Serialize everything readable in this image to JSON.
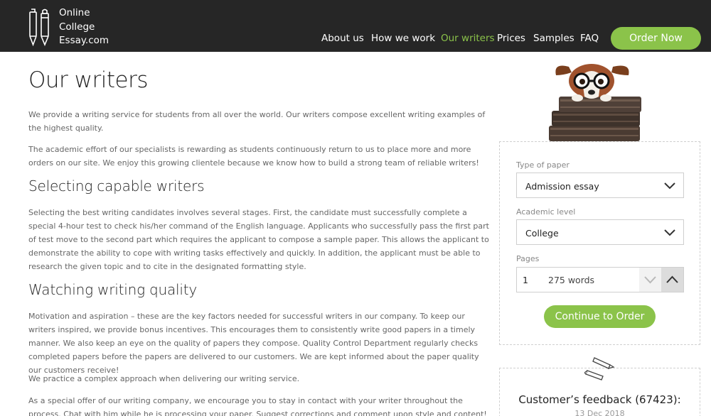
{
  "brand": {
    "line1": "Online",
    "line2": "College",
    "line3": "Essay.com"
  },
  "nav": {
    "items": [
      "About us",
      "How we work",
      "Our writers",
      "Prices",
      "Samples",
      "FAQ"
    ],
    "active": "Our writers",
    "order_label": "Order Now"
  },
  "colors": {
    "header_bg": "#262626",
    "accent": "#8bc34a"
  },
  "main": {
    "title": "Our writers",
    "intro_1": "We provide a writing service for students from all over the world. Our writers compose excellent writing examples of the highest quality.",
    "intro_2": "The academic effort of our specialists is rewarding as students continuously return to us to place more and more orders on our site. We enjoy this growing clientele because we know how to build a strong team of reliable writers!",
    "h_selecting": "Selecting capable writers",
    "selecting_text": "Selecting the best writing candidates involves several stages. First, the candidate must successfully complete a special 4-hour test to check his/her command of the English language. Applicants who successfully pass the first part of test move to the second part which requires the applicant to compose a sample paper. This allows the applicant to demonstrate the ability to cope with writing tasks effectively and quickly. In addition, the applicant must be able to research the given topic and to cite in the designated formatting style.",
    "h_watching": "Watching writing quality",
    "watching_text": "Motivation and aspiration – these are the key factors needed for successful writers in our company. To keep our writers inspired, we provide bonus incentives. This encourages them to consistently write good papers in a timely manner. We also keep an eye on the quality of papers they compose. Quality Control Department regularly checks completed papers before the papers are delivered to our customers. We are kept informed about the paper quality our customers receive!",
    "complex_text": "We practice a complex approach when delivering our writing service.",
    "offer_text": "As a special offer of our writing company, we encourage you to stay in contact with your writer throughout the process. Chat with him while he is processing your paper. Suggest corrections and comment upon style and content! Be the manager of"
  },
  "order_form": {
    "paper_label": "Type of paper",
    "paper_value": "Admission essay",
    "level_label": "Academic level",
    "level_value": "College",
    "pages_label": "Pages",
    "pages_value": "1",
    "words_value": "275 words",
    "continue_label": "Continue to Order"
  },
  "feedback": {
    "title": "Customer’s feedback (67423):",
    "date": "13 Dec 2018"
  }
}
